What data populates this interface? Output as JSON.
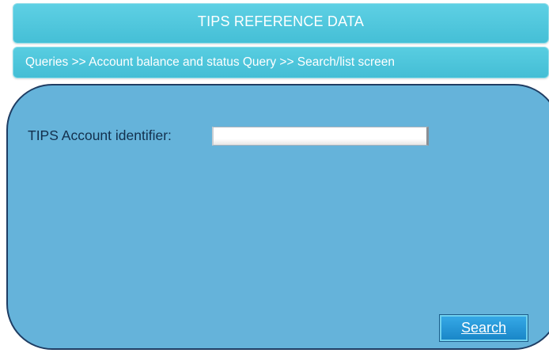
{
  "header": {
    "title": "TIPS REFERENCE DATA"
  },
  "breadcrumb": {
    "text": "Queries >> Account balance and status Query >> Search/list screen"
  },
  "form": {
    "account_identifier_label": "TIPS Account identifier:",
    "account_identifier_value": "",
    "search_button_label": "Search"
  },
  "colors": {
    "header_bg": "#4fc6dc",
    "panel_bg": "#65b3da",
    "panel_border": "#1f3d63",
    "button_bg": "#1f8fd0",
    "label_text": "#13304d"
  }
}
